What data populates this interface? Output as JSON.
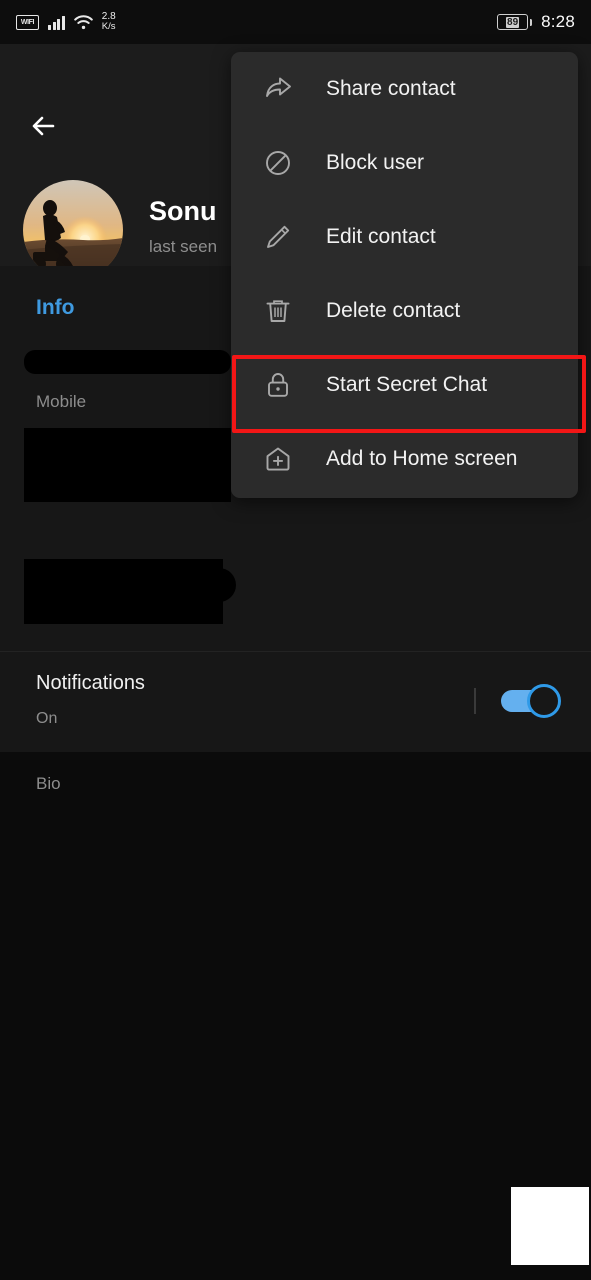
{
  "status_bar": {
    "wifi_label": "WIFI",
    "signal_icon": "signal-bars-icon",
    "wifi_icon": "wifi-icon",
    "network_speed_value": "2.8",
    "network_speed_unit": "K/s",
    "battery_level": "89",
    "battery_icon": "battery-icon",
    "time": "8:28"
  },
  "profile": {
    "back_icon": "back-arrow-icon",
    "avatar_icon": "avatar-sunset-motorcycle",
    "name": "Sonu",
    "status": "last seen"
  },
  "info": {
    "tab_label": "Info",
    "phone_label": "Mobile",
    "phone_value": "",
    "bio_label": "Bio",
    "bio_value": "",
    "notifications_title": "Notifications",
    "notifications_state": "On",
    "notifications_toggle": "on"
  },
  "menu": {
    "items": [
      {
        "label": "Share contact",
        "icon": "share-arrow-icon",
        "name": "menu-item-share-contact"
      },
      {
        "label": "Block user",
        "icon": "block-circle-icon",
        "name": "menu-item-block-user"
      },
      {
        "label": "Edit contact",
        "icon": "pencil-icon",
        "name": "menu-item-edit-contact"
      },
      {
        "label": "Delete contact",
        "icon": "trash-icon",
        "name": "menu-item-delete-contact"
      },
      {
        "label": "Start Secret Chat",
        "icon": "lock-icon",
        "name": "menu-item-start-secret-chat"
      },
      {
        "label": "Add to Home screen",
        "icon": "home-plus-icon",
        "name": "menu-item-add-to-home-screen"
      }
    ]
  },
  "annotation": {
    "highlight_target": "Start Secret Chat",
    "highlight_color": "#f31616"
  },
  "colors": {
    "page_background": "#0b0b0b",
    "content_background": "#171717",
    "header_background": "#1c1c1c",
    "menu_background": "#2b2b2b",
    "accent_blue": "#3f9ae0",
    "toggle_track": "#64b0ef",
    "toggle_ring": "#2f9ae8",
    "highlight_red": "#f31616"
  }
}
